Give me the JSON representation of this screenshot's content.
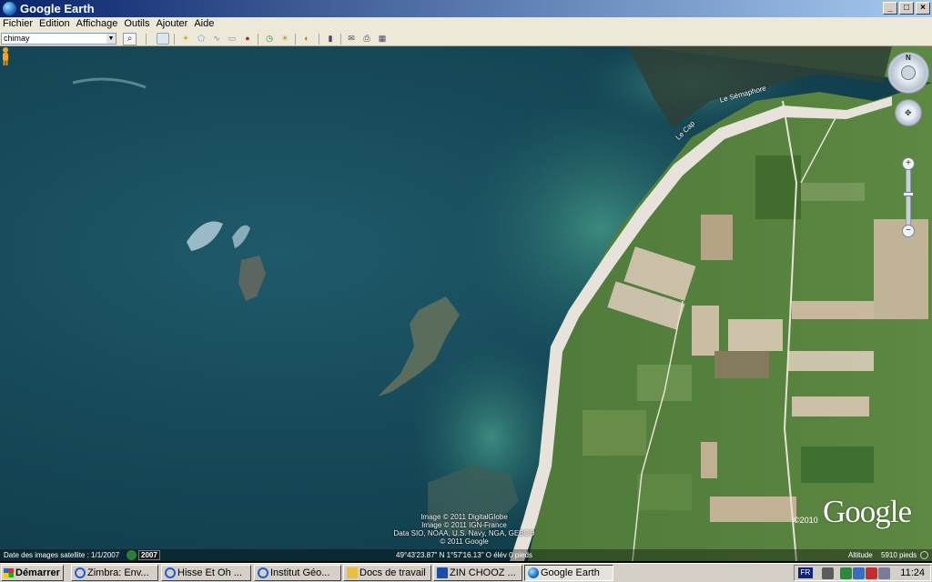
{
  "window": {
    "title": "Google Earth",
    "controls": [
      "_",
      "□",
      "×"
    ]
  },
  "menu": [
    "Fichier",
    "Edition",
    "Affichage",
    "Outils",
    "Ajouter",
    "Aide"
  ],
  "search": {
    "value": "chimay"
  },
  "map": {
    "labels": {
      "semaphore": "Le Sémaphore",
      "cap": "Le Cap"
    },
    "copyright": [
      "Image © 2011 DigitalGlobe",
      "Image © 2011 IGN-France",
      "Data SIO, NOAA, U.S. Navy, NGA, GEBCO",
      "© 2011 Google"
    ],
    "logo": "Google",
    "logo_year": "©2010",
    "nav_north": "N"
  },
  "status": {
    "imagery_date": "Date des images satellite : 1/1/2007",
    "imagery_year": "2007",
    "coordinates": "49°43'23.87\" N    1°57'16.13\" O  élév    0 pieds",
    "altitude_label": "Altitude",
    "altitude_value": "5910 pieds"
  },
  "taskbar": {
    "start": "Démarrer",
    "tasks": [
      {
        "label": "Zimbra: Env...",
        "icon_color": "#1e5bd6"
      },
      {
        "label": "Hisse Et Oh ...",
        "icon_color": "#1e5bd6"
      },
      {
        "label": "Institut Géo...",
        "icon_color": "#1e5bd6"
      },
      {
        "label": "Docs de travail",
        "icon_color": "#e8c040"
      },
      {
        "label": "ZIN CHOOZ ...",
        "icon_color": "#1a4fa8"
      },
      {
        "label": "Google Earth",
        "icon_color": "#2a7fd0"
      }
    ],
    "lang": "FR",
    "clock": "11:24"
  }
}
